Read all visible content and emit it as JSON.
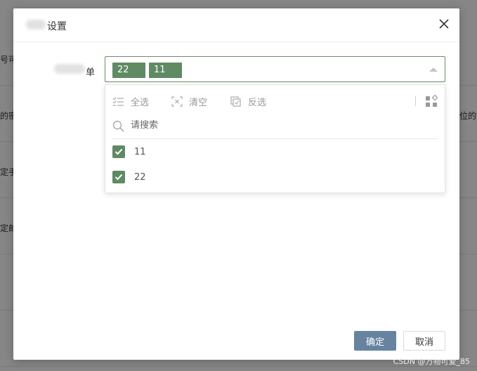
{
  "background": {
    "rows": [
      {
        "text": "号可"
      },
      {
        "text": "的密"
      },
      {
        "text": "定手"
      },
      {
        "text": "定邮"
      }
    ],
    "right_text": "位的密"
  },
  "dialog": {
    "title": "设置",
    "close_icon": "close-icon",
    "form": {
      "label": "单",
      "selected_tags": [
        "22",
        "11"
      ]
    },
    "dropdown": {
      "toolbar": {
        "select_all": "全选",
        "clear": "清空",
        "invert": "反选"
      },
      "search_placeholder": "请搜索",
      "options": [
        {
          "label": "11",
          "checked": true
        },
        {
          "label": "22",
          "checked": true
        }
      ]
    },
    "footer": {
      "ok": "确定",
      "cancel": "取消"
    }
  },
  "watermark": "CSDN @万物可爱_85",
  "colors": {
    "tag": "#5f8a64",
    "checkbox": "#5f8a64",
    "primary_button": "#6683a0",
    "select_border": "#6a8a68"
  }
}
